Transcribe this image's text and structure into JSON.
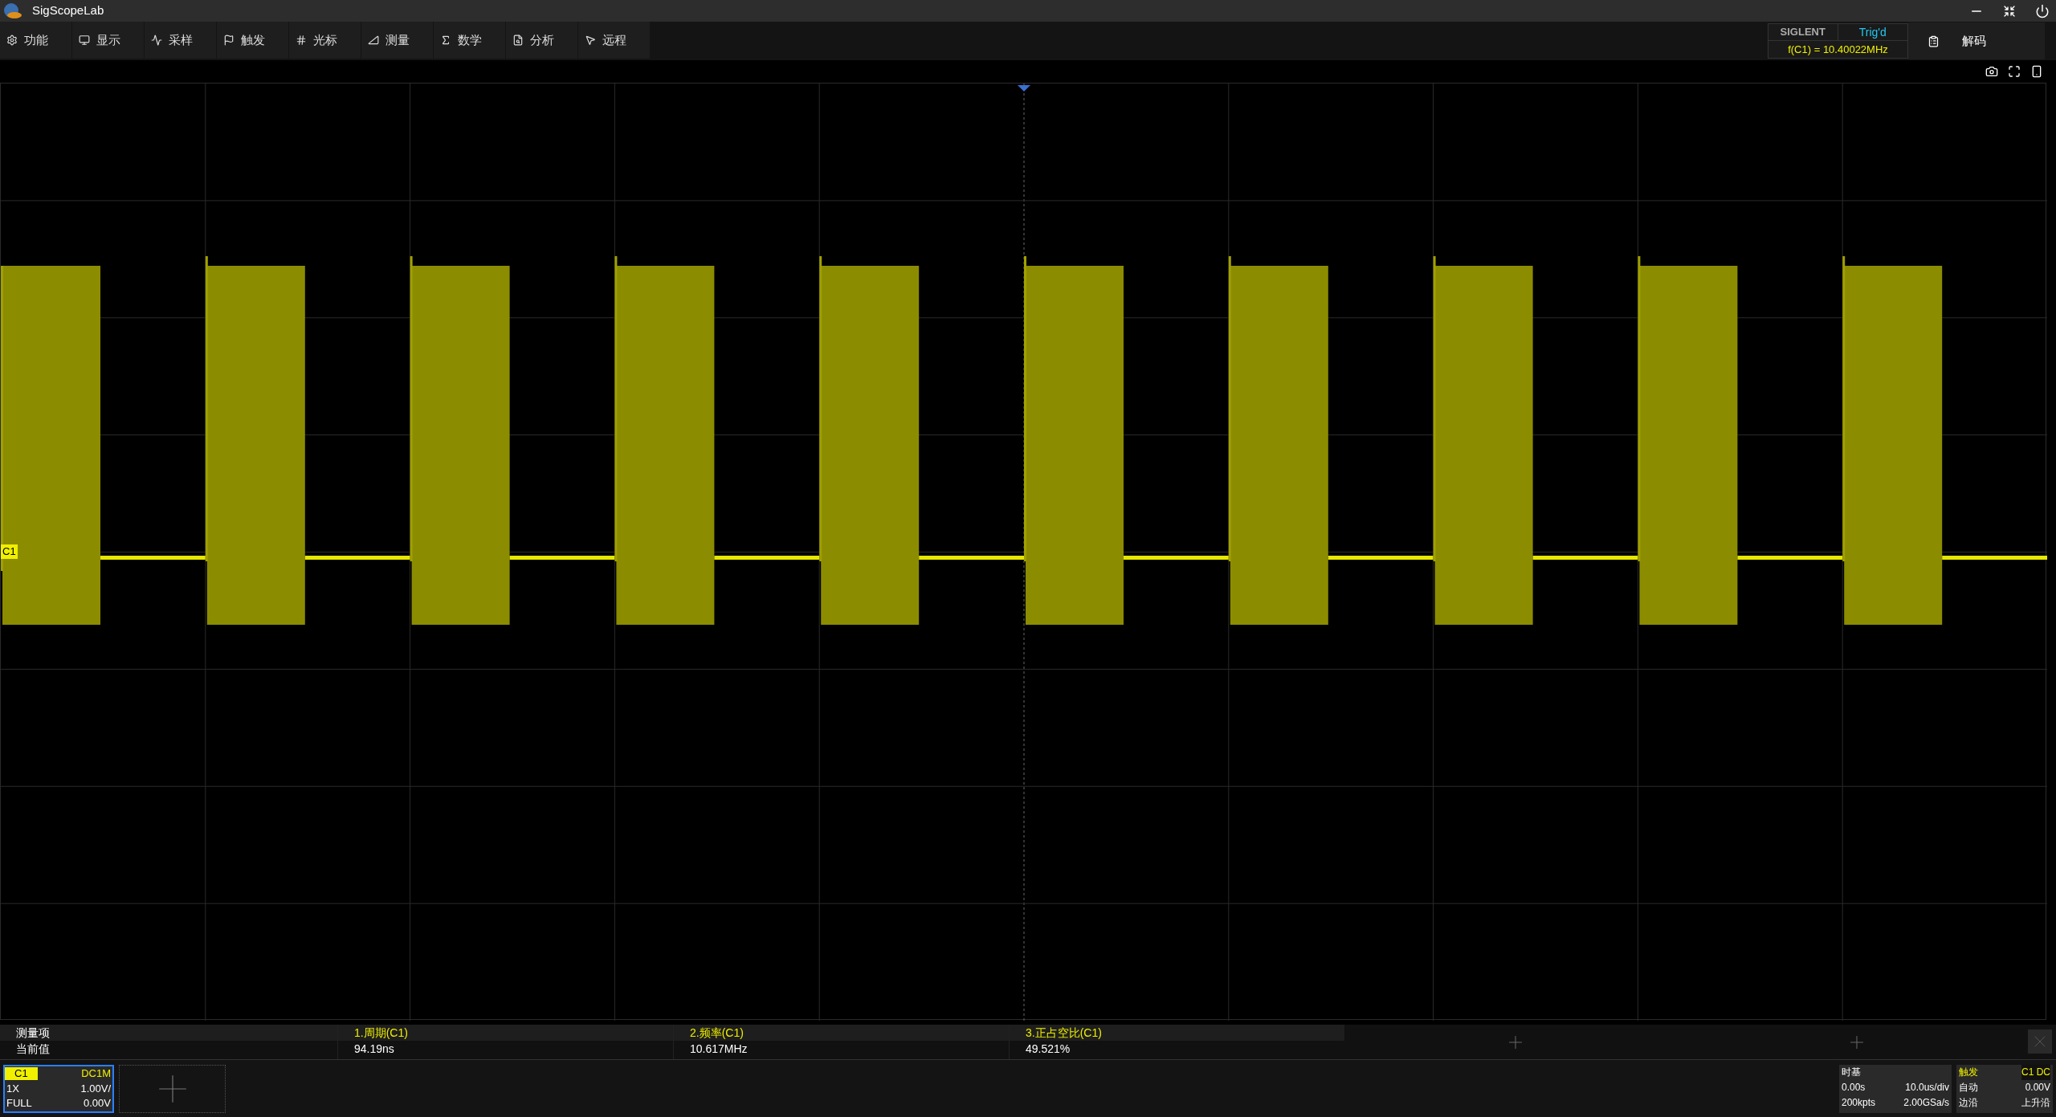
{
  "window": {
    "title": "SigScopeLab"
  },
  "menu": [
    {
      "label": "功能",
      "kind": "gear"
    },
    {
      "label": "显示",
      "kind": "monitor"
    },
    {
      "label": "采样",
      "kind": "sample"
    },
    {
      "label": "触发",
      "kind": "flag"
    },
    {
      "label": "光标",
      "kind": "cursor"
    },
    {
      "label": "测量",
      "kind": "ruler"
    },
    {
      "label": "数学",
      "kind": "math"
    },
    {
      "label": "分析",
      "kind": "analysis"
    },
    {
      "label": "远程",
      "kind": "remote"
    }
  ],
  "status": {
    "brand": "SIGLENT",
    "trigger_state": "Trig'd",
    "frequency": "f(C1) = 10.40022MHz"
  },
  "decode_button": {
    "label": "解码"
  },
  "channel_marker": "C1",
  "measurements": {
    "header_label": "测量项",
    "value_label": "当前值",
    "items": [
      {
        "name": "1.周期(C1)",
        "value": "94.19ns"
      },
      {
        "name": "2.频率(C1)",
        "value": "10.617MHz"
      },
      {
        "name": "3.正占空比(C1)",
        "value": "49.521%"
      }
    ]
  },
  "channel_box": {
    "name": "C1",
    "coupling": "DC1M",
    "probe": "1X",
    "scale": "1.00V/",
    "bandwidth": "FULL",
    "offset": "0.00V",
    "selected": true
  },
  "timebase": {
    "title": "时基",
    "delay": "0.00s",
    "scale": "10.0us/div",
    "memory": "200kpts",
    "sample_rate": "2.00GSa/s"
  },
  "trigger": {
    "title": "触发",
    "source": "C1 DC",
    "mode": "自动",
    "threshold": "0.00V",
    "type": "边沿",
    "slope": "上升沿"
  }
}
